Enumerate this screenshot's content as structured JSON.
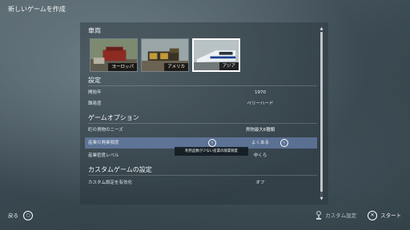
{
  "page": {
    "title": "新しいゲームを作成"
  },
  "sections": {
    "vehicles": "車両",
    "settings": "設定",
    "game_options": "ゲームオプション",
    "custom_game": "カスタムゲームの設定"
  },
  "region_cards": [
    {
      "label": "ヨーロッパ",
      "selected": false
    },
    {
      "label": "アメリカ",
      "selected": false
    },
    {
      "label": "アジア",
      "selected": true
    }
  ],
  "settings_rows": [
    {
      "label": "開始年",
      "value": "1970"
    },
    {
      "label": "難易度",
      "value": "ベリーハード"
    }
  ],
  "option_rows": [
    {
      "label": "町の貨物のニーズ",
      "value": "貨物最大6種類"
    },
    {
      "label": "産業の廃業頻度",
      "value": "よくある"
    },
    {
      "label": "産業密度レベル",
      "value": "中くら"
    }
  ],
  "custom_rows": [
    {
      "label": "カスタム設定を有効化",
      "value": "オフ"
    }
  ],
  "tooltip": "利用品数が少ない産業の廃業頻度",
  "footer": {
    "back_label": "戻る",
    "custom_label": "カスタム設定",
    "start_label": "スタート"
  },
  "colors": {
    "highlight": "#7896cd",
    "selected_border": "#ffffff"
  }
}
